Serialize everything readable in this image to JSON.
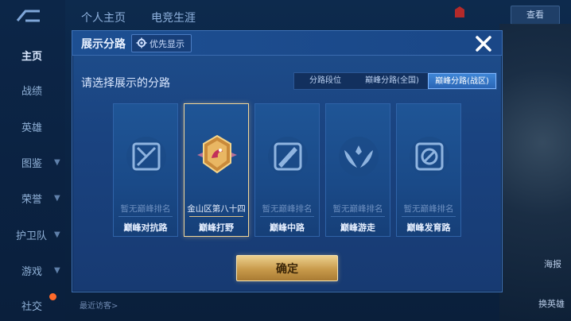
{
  "nav": {
    "items": [
      {
        "label": "主页"
      },
      {
        "label": "战绩"
      },
      {
        "label": "英雄"
      },
      {
        "label": "图鉴"
      },
      {
        "label": "荣誉"
      },
      {
        "label": "护卫队"
      },
      {
        "label": "游戏"
      },
      {
        "label": "社交"
      }
    ]
  },
  "topbar": {
    "tabs": [
      "个人主页",
      "电竞生涯"
    ],
    "right_button": "查看"
  },
  "background": {
    "recent_visitors": "最近访客>",
    "right_labels": [
      "海报",
      "换英雄"
    ]
  },
  "modal": {
    "title": "展示分路",
    "priority_label": "优先显示",
    "prompt": "请选择展示的分路",
    "tabs": [
      {
        "label": "分路段位",
        "active": false
      },
      {
        "label": "巅峰分路(全国)",
        "active": false
      },
      {
        "label": "巅峰分路(战区)",
        "active": true
      }
    ],
    "cards": [
      {
        "rank": "暂无巅峰排名",
        "name": "巅峰对抗路",
        "icon": "sword-shield-icon",
        "selected": false
      },
      {
        "rank": "金山区第八十四",
        "name": "巅峰打野",
        "icon": "jungle-badge-icon",
        "selected": true
      },
      {
        "rank": "暂无巅峰排名",
        "name": "巅峰中路",
        "icon": "mid-lane-icon",
        "selected": false
      },
      {
        "rank": "暂无巅峰排名",
        "name": "巅峰游走",
        "icon": "wings-icon",
        "selected": false
      },
      {
        "rank": "暂无巅峰排名",
        "name": "巅峰发育路",
        "icon": "circle-slash-icon",
        "selected": false
      }
    ],
    "confirm_label": "确定"
  },
  "colors": {
    "accent": "#3f86d6",
    "gold": "#c89a4b",
    "badge": "#ff6a2a"
  }
}
